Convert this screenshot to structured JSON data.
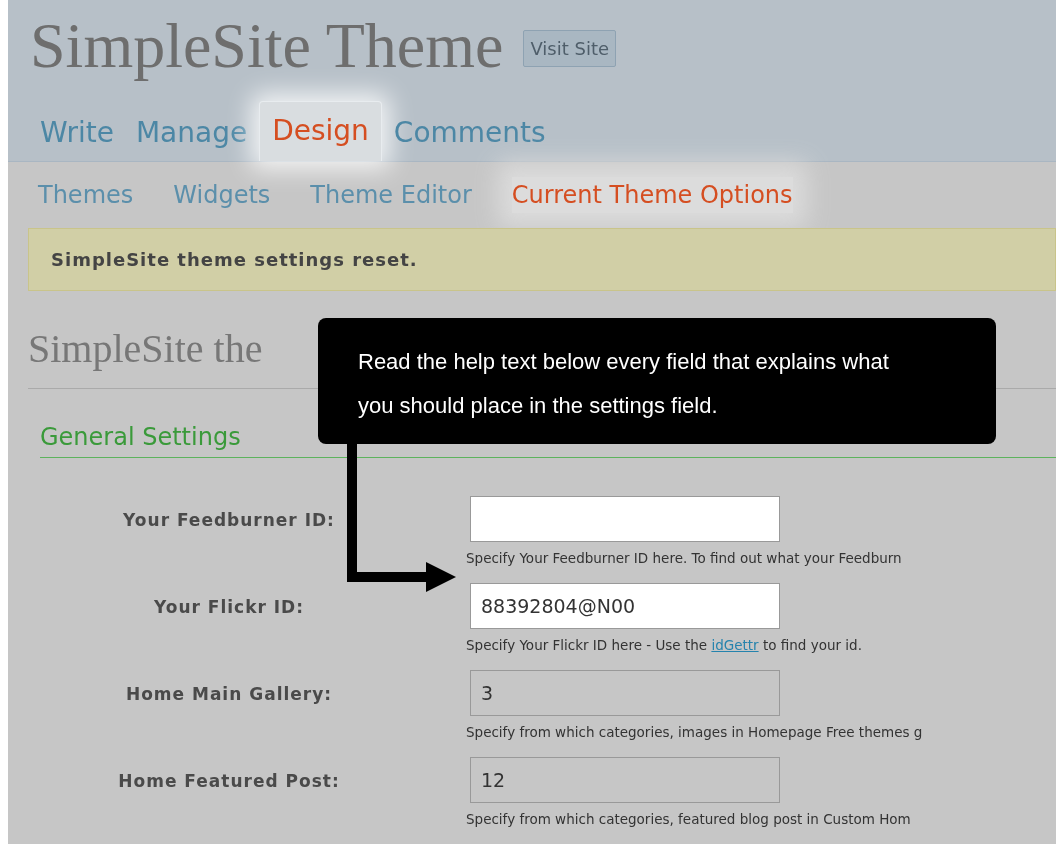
{
  "site_title": "SimpleSite Theme",
  "visit_site_button": "Visit Site",
  "tabs": [
    {
      "label": "Write",
      "selected": false
    },
    {
      "label": "Manage",
      "selected": false
    },
    {
      "label": "Design",
      "selected": true
    },
    {
      "label": "Comments",
      "selected": false
    }
  ],
  "subtabs": [
    {
      "label": "Themes",
      "selected": false
    },
    {
      "label": "Widgets",
      "selected": false
    },
    {
      "label": "Theme Editor",
      "selected": false
    },
    {
      "label": "Current Theme Options",
      "selected": true
    }
  ],
  "notice": "SimpleSite theme settings reset.",
  "page_heading": "SimpleSite the",
  "section_heading": "General Settings",
  "fields": [
    {
      "label": "Your Feedburner ID:",
      "highlighted": true,
      "help": "Specify Your Feedburner ID here. To find out what your Feedburn"
    },
    {
      "label": "Your Flickr ID:",
      "value": "88392804@N00",
      "highlighted": true,
      "help": "Specify Your Flickr ID here - Use the ",
      "help_link": "idGettr",
      "help_after": " to find your id."
    },
    {
      "label": "Home Main Gallery:",
      "value": "3",
      "highlighted": false,
      "help": "Specify from which categories, images in Homepage Free themes g"
    },
    {
      "label": "Home Featured Post:",
      "value": "12",
      "highlighted": false,
      "help": "Specify from which categories, featured blog post in Custom Hom"
    }
  ],
  "callout": "Read the help text below every field that explains what you should place in the settings field."
}
